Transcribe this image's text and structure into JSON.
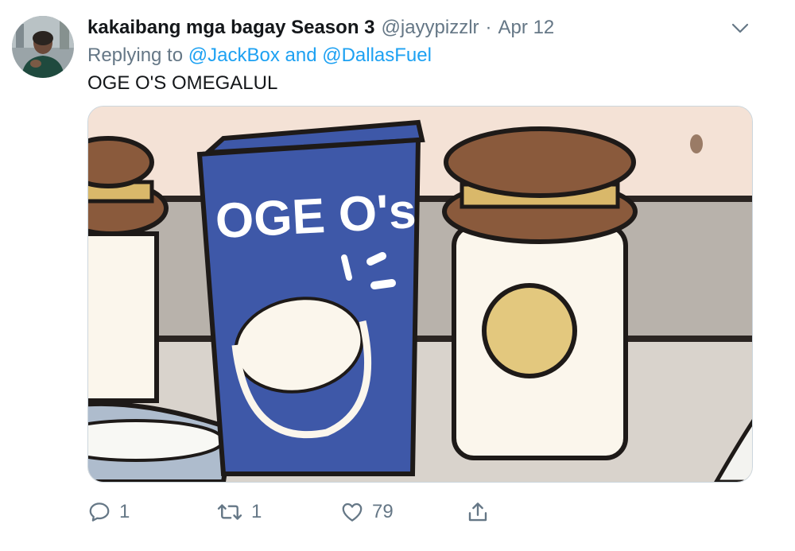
{
  "tweet": {
    "display_name": "kakaibang mga bagay Season 3",
    "handle": "@jayypizzlr",
    "separator": "·",
    "date": "Apr 12",
    "replying_prefix": "Replying to",
    "reply_to_1": "@JackBox",
    "reply_joiner": "and",
    "reply_to_2": "@DallasFuel",
    "text": "OGE O'S OMEGALUL"
  },
  "media": {
    "box_text": "OGE O's"
  },
  "actions": {
    "reply_count": "1",
    "retweet_count": "1",
    "like_count": "79"
  },
  "icons": [
    "caret-down-icon",
    "reply-icon",
    "retweet-icon",
    "like-icon",
    "share-icon"
  ],
  "colors": {
    "link": "#1da1f2",
    "muted": "#657786",
    "text": "#14171a"
  }
}
